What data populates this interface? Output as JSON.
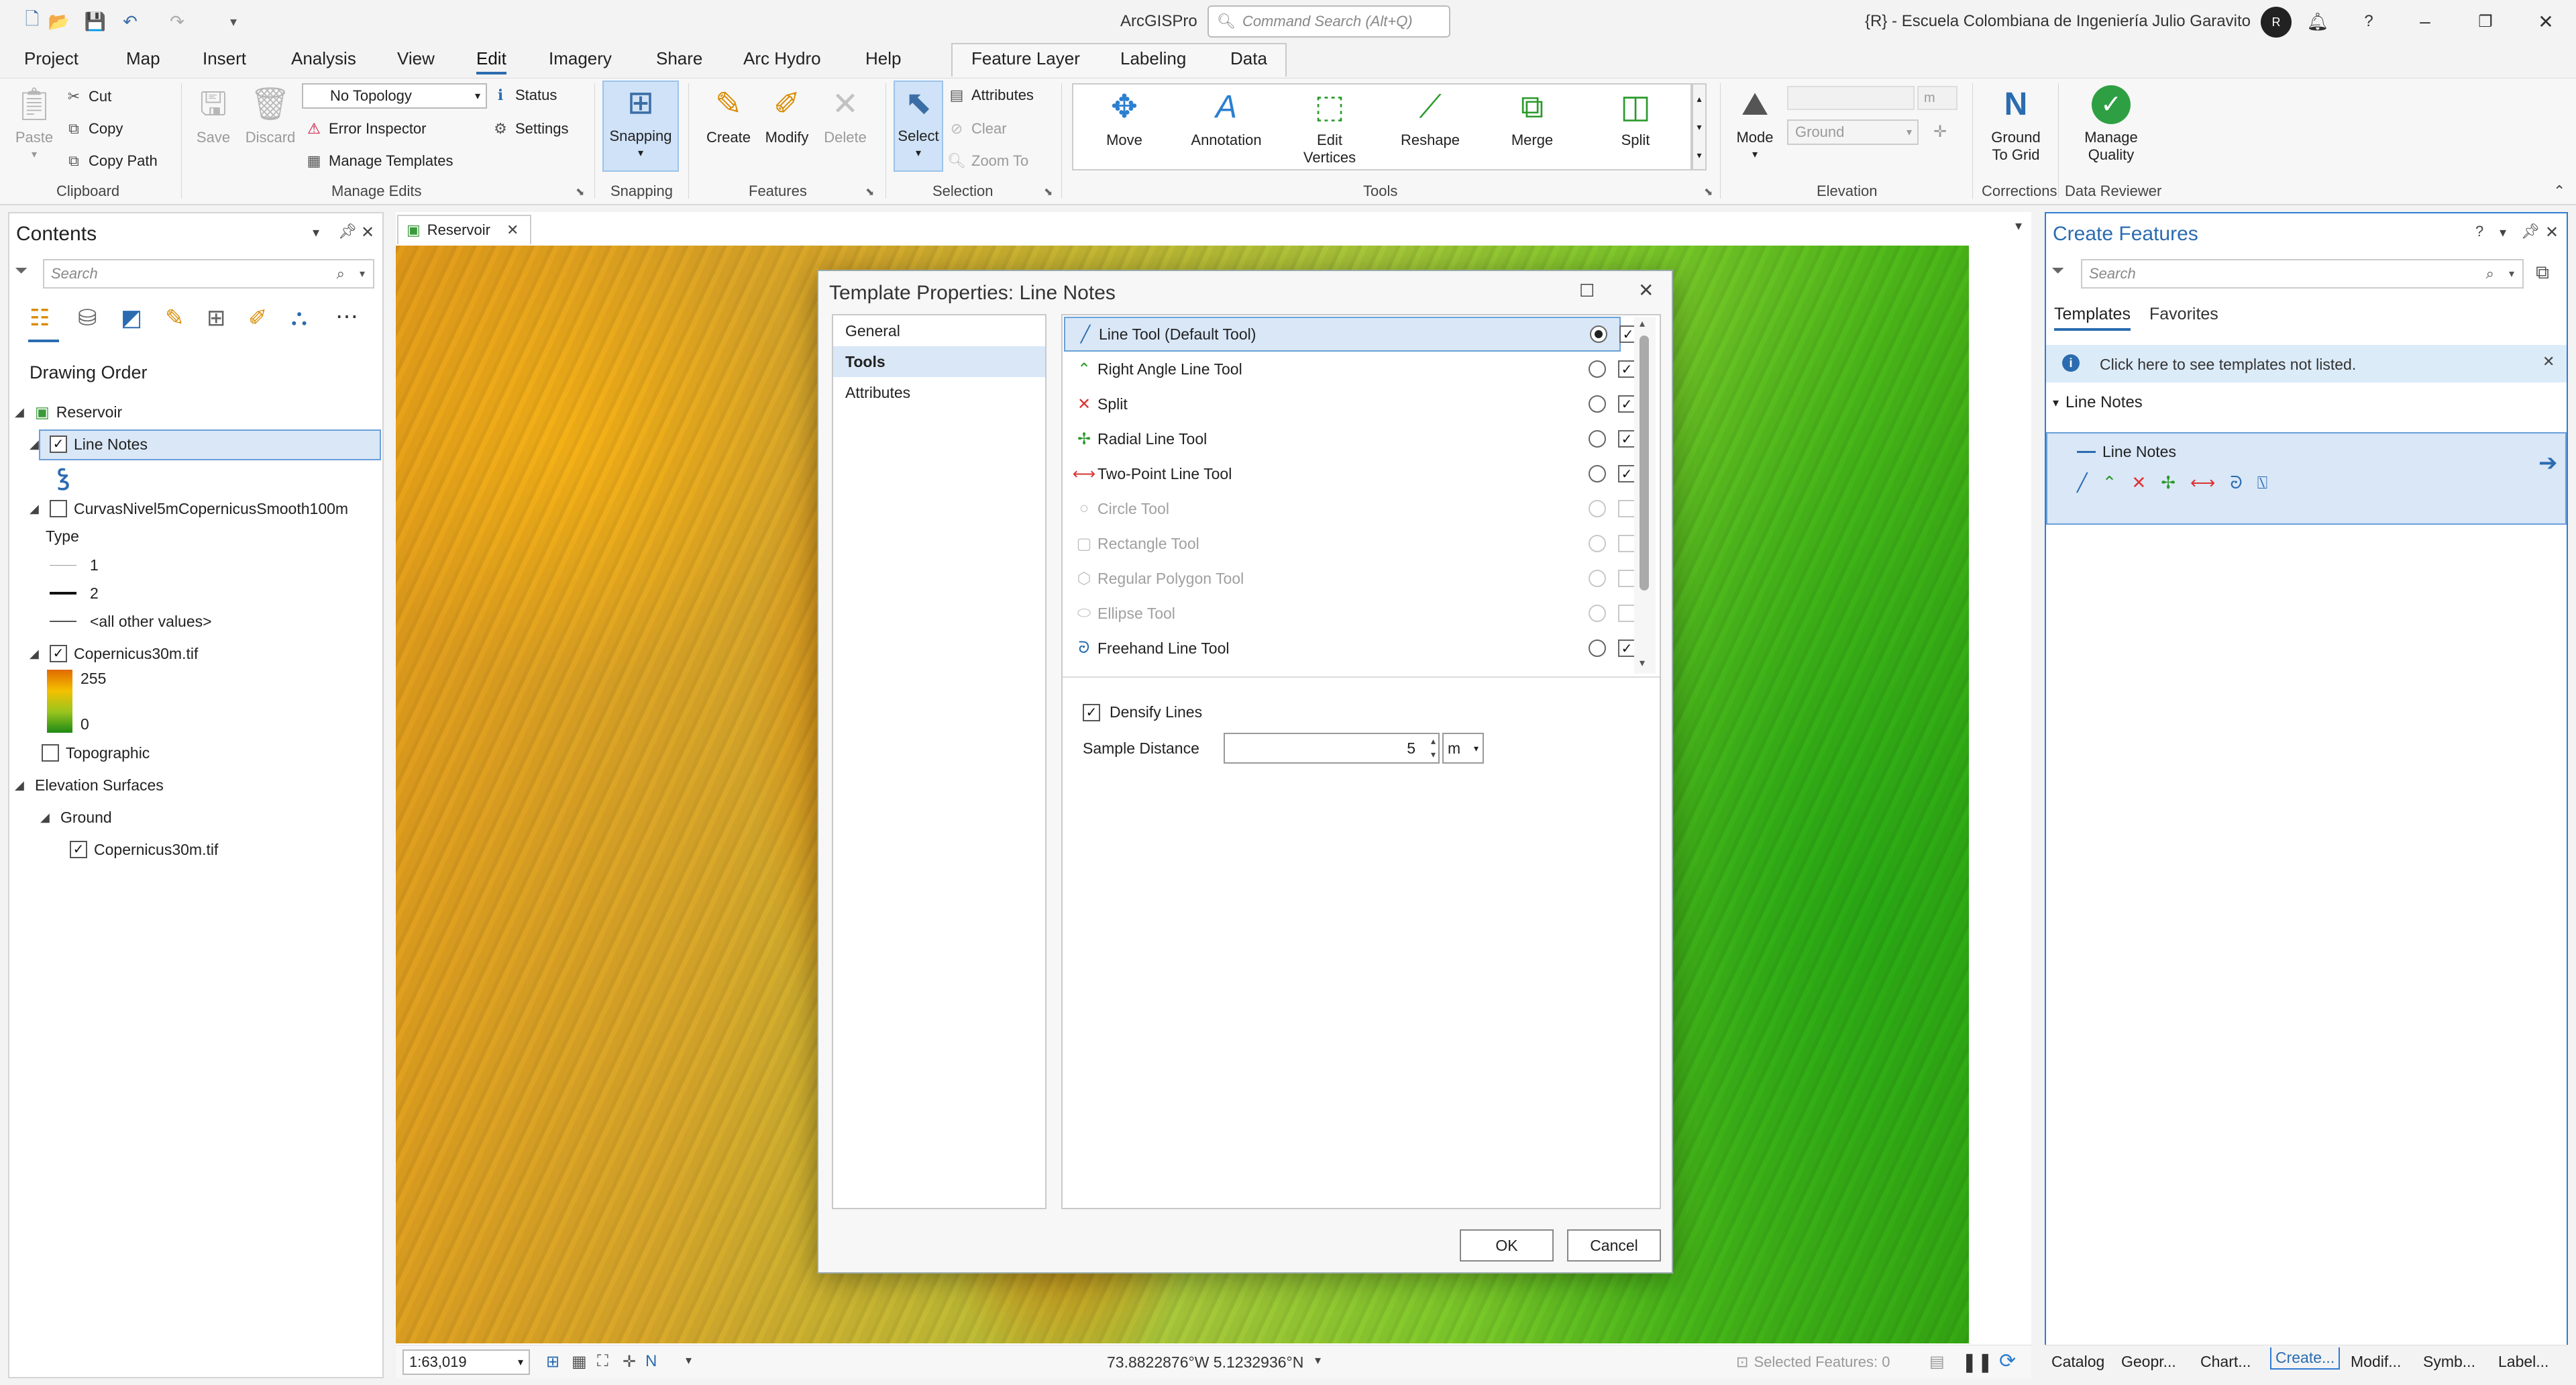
{
  "app": {
    "name": "ArcGISPro",
    "command_search_placeholder": "Command Search (Alt+Q)",
    "user_title": "{R} - Escuela Colombiana de Ingeniería Julio Garavito",
    "avatar_initials": "R"
  },
  "ribbon_tabs": [
    "Project",
    "Map",
    "Insert",
    "Analysis",
    "View",
    "Edit",
    "Imagery",
    "Share",
    "Arc Hydro",
    "Help",
    "Feature Layer",
    "Labeling",
    "Data"
  ],
  "active_tab": "Edit",
  "ribbon": {
    "clipboard": {
      "paste": "Paste",
      "cut": "Cut",
      "copy": "Copy",
      "copy_path": "Copy Path",
      "group": "Clipboard"
    },
    "manage_edits": {
      "save": "Save",
      "discard": "Discard",
      "topology": "No Topology",
      "error_inspector": "Error Inspector",
      "manage_templates": "Manage Templates",
      "status": "Status",
      "settings": "Settings",
      "group": "Manage Edits"
    },
    "snapping": {
      "label": "Snapping",
      "group": "Snapping"
    },
    "features": {
      "create": "Create",
      "modify": "Modify",
      "delete": "Delete",
      "group": "Features"
    },
    "selection": {
      "select": "Select",
      "attributes": "Attributes",
      "clear": "Clear",
      "zoom_to": "Zoom To",
      "group": "Selection"
    },
    "tools": {
      "move": "Move",
      "annotation": "Annotation",
      "edit_vertices": "Edit Vertices",
      "reshape": "Reshape",
      "merge": "Merge",
      "split": "Split",
      "group": "Tools"
    },
    "elevation": {
      "mode": "Mode",
      "surface": "Ground",
      "unit": "m",
      "group": "Elevation"
    },
    "corrections": {
      "ground_to_grid": "Ground To Grid",
      "group": "Corrections"
    },
    "data_reviewer": {
      "manage_quality": "Manage Quality",
      "group": "Data Reviewer"
    }
  },
  "contents": {
    "title": "Contents",
    "search_placeholder": "Search",
    "drawing_order": "Drawing Order",
    "map_name": "Reservoir",
    "layer1": "Line Notes",
    "layer2": "CurvasNivel5mCopernicusSmooth100m",
    "type_label": "Type",
    "type_1": "1",
    "type_2": "2",
    "type_other": "<all other values>",
    "layer3": "Copernicus30m.tif",
    "ramp_high": "255",
    "ramp_low": "0",
    "layer4": "Topographic",
    "elev_surfaces": "Elevation Surfaces",
    "ground": "Ground",
    "ground_layer": "Copernicus30m.tif"
  },
  "map": {
    "tab": "Reservoir",
    "scale": "1:63,019",
    "coords": "73.8822876°W 5.1232936°N",
    "selected_features": "Selected Features: 0"
  },
  "dialog": {
    "title": "Template Properties: Line Notes",
    "nav": [
      "General",
      "Tools",
      "Attributes"
    ],
    "selected_nav": "Tools",
    "tools": [
      {
        "label": "Line Tool  (Default Tool)",
        "icon": "line-icon",
        "default": true,
        "checked": true,
        "enabled": true
      },
      {
        "label": "Right Angle Line Tool",
        "icon": "right-angle-icon",
        "default": false,
        "checked": true,
        "enabled": true
      },
      {
        "label": "Split",
        "icon": "split-icon",
        "default": false,
        "checked": true,
        "enabled": true
      },
      {
        "label": "Radial Line Tool",
        "icon": "radial-icon",
        "default": false,
        "checked": true,
        "enabled": true
      },
      {
        "label": "Two-Point Line Tool",
        "icon": "two-point-icon",
        "default": false,
        "checked": true,
        "enabled": true
      },
      {
        "label": "Circle Tool",
        "icon": "circle-icon",
        "default": false,
        "checked": false,
        "enabled": false
      },
      {
        "label": "Rectangle Tool",
        "icon": "rectangle-icon",
        "default": false,
        "checked": false,
        "enabled": false
      },
      {
        "label": "Regular Polygon Tool",
        "icon": "polygon-icon",
        "default": false,
        "checked": false,
        "enabled": false
      },
      {
        "label": "Ellipse Tool",
        "icon": "ellipse-icon",
        "default": false,
        "checked": false,
        "enabled": false
      },
      {
        "label": "Freehand Line Tool",
        "icon": "freehand-icon",
        "default": false,
        "checked": true,
        "enabled": true
      }
    ],
    "densify_label": "Densify Lines",
    "densify_checked": true,
    "sample_distance_label": "Sample Distance",
    "sample_distance_value": "5",
    "sample_distance_unit": "m",
    "ok": "OK",
    "cancel": "Cancel"
  },
  "create_features": {
    "title": "Create Features",
    "search_placeholder": "Search",
    "tab_templates": "Templates",
    "tab_favorites": "Favorites",
    "info": "Click here to see templates not listed.",
    "group": "Line Notes",
    "template": "Line Notes"
  },
  "bottom_tabs": [
    "Catalog",
    "Geopr...",
    "Chart...",
    "Create...",
    "Modif...",
    "Symb...",
    "Label..."
  ],
  "active_bottom_tab": "Create...",
  "colors": {
    "accent": "#2b6cb0",
    "selection": "#d9e7f7",
    "pane_border": "#2f7bd3"
  }
}
